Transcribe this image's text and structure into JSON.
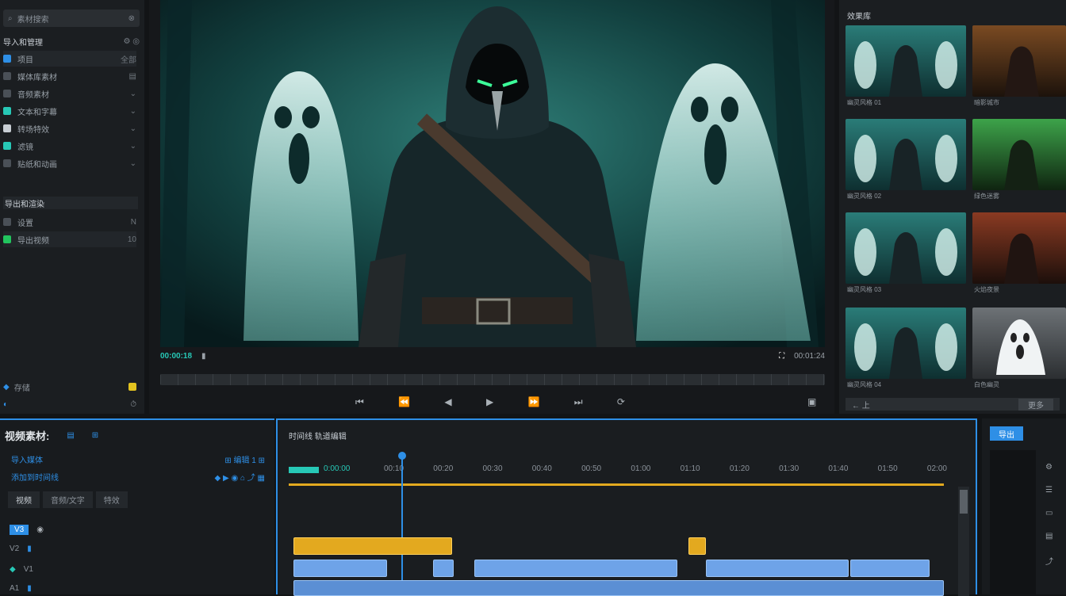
{
  "left_panel": {
    "search_placeholder": "素材搜索",
    "section_title": "导入和管理",
    "items": [
      {
        "label": "项目",
        "right": "全部"
      },
      {
        "label": "媒体库素材",
        "right": "▤"
      },
      {
        "label": "音频素材",
        "right": "⌄"
      },
      {
        "label": "文本和字幕",
        "right": "⌄"
      },
      {
        "label": "转场特效",
        "right": "⌄"
      },
      {
        "label": "滤镜",
        "right": "⌄"
      },
      {
        "label": "贴纸和动画",
        "right": "⌄"
      }
    ],
    "section2_title": "导出和渲染",
    "items2": [
      {
        "label": "设置",
        "right": "N"
      },
      {
        "label": "导出视频",
        "right": "10"
      }
    ],
    "footer_label": "存储",
    "footer_value": "⏱"
  },
  "preview": {
    "timecode": "00:00:18",
    "playbar_time_right": "00:01:24",
    "controls": [
      "⏮",
      "⏪",
      "◀",
      "▶",
      "⏩",
      "⏭",
      "⟳",
      "▣"
    ]
  },
  "right_panel": {
    "title": "效果库",
    "footer_left": "← 上",
    "footer_right": "更多",
    "thumbnails": [
      {
        "caption": "幽灵风格 01",
        "tone": "teal"
      },
      {
        "caption": "暗影城市",
        "tone": "orange"
      },
      {
        "caption": "幽灵风格 02",
        "tone": "teal"
      },
      {
        "caption": "绿色迷雾",
        "tone": "green"
      },
      {
        "caption": "幽灵风格 03",
        "tone": "teal"
      },
      {
        "caption": "火焰夜景",
        "tone": "red"
      },
      {
        "caption": "幽灵风格 04",
        "tone": "teal"
      },
      {
        "caption": "白色幽灵",
        "tone": "white"
      }
    ]
  },
  "bottom_left": {
    "title": "视频素材:",
    "tab_a": "▤",
    "tab_b": "⊞",
    "row1_left": "导入媒体",
    "row1_right": "⊞ 编辑 1 ⊞",
    "row2_left": "添加到时间线",
    "row2_right": "◆ ▶ ◉ ⌂ ⤴ ▦",
    "tabs": [
      "视频",
      "音频/文字",
      "特效"
    ],
    "track_labels": [
      "V3",
      "V2",
      "V1",
      "A1"
    ]
  },
  "timeline": {
    "title": "时间线 轨道编辑",
    "markers": [
      "00:00",
      "00:10",
      "00:20",
      "00:30",
      "00:40",
      "00:50",
      "01:00",
      "01:10",
      "01:20",
      "01:30",
      "01:40",
      "01:50",
      "02:00"
    ],
    "range_label": "0:00:00"
  },
  "far_right": {
    "button": "导出"
  },
  "colors": {
    "accent": "#2e8fe6",
    "teal": "#27c8b6",
    "selection": "#e3a91f",
    "clip": "#6ea3e8",
    "green": "#22c55e"
  }
}
